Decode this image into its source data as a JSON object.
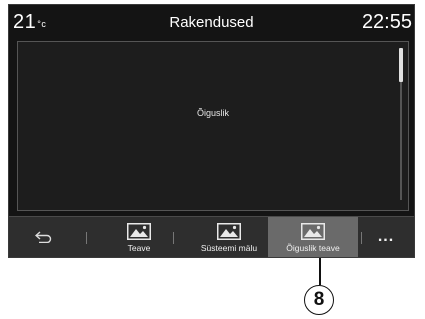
{
  "status": {
    "temperature": "21",
    "temp_unit": "°c",
    "title": "Rakendused",
    "time": "22:55"
  },
  "content": {
    "text": "Õiguslik"
  },
  "tabs": [
    {
      "label": "Teave",
      "icon": "image-icon",
      "active": false
    },
    {
      "label": "Süsteemi mälu",
      "icon": "image-icon",
      "active": false
    },
    {
      "label": "Õiguslik teave",
      "icon": "image-icon",
      "active": true
    }
  ],
  "more_label": "...",
  "callout": {
    "number": "8"
  }
}
